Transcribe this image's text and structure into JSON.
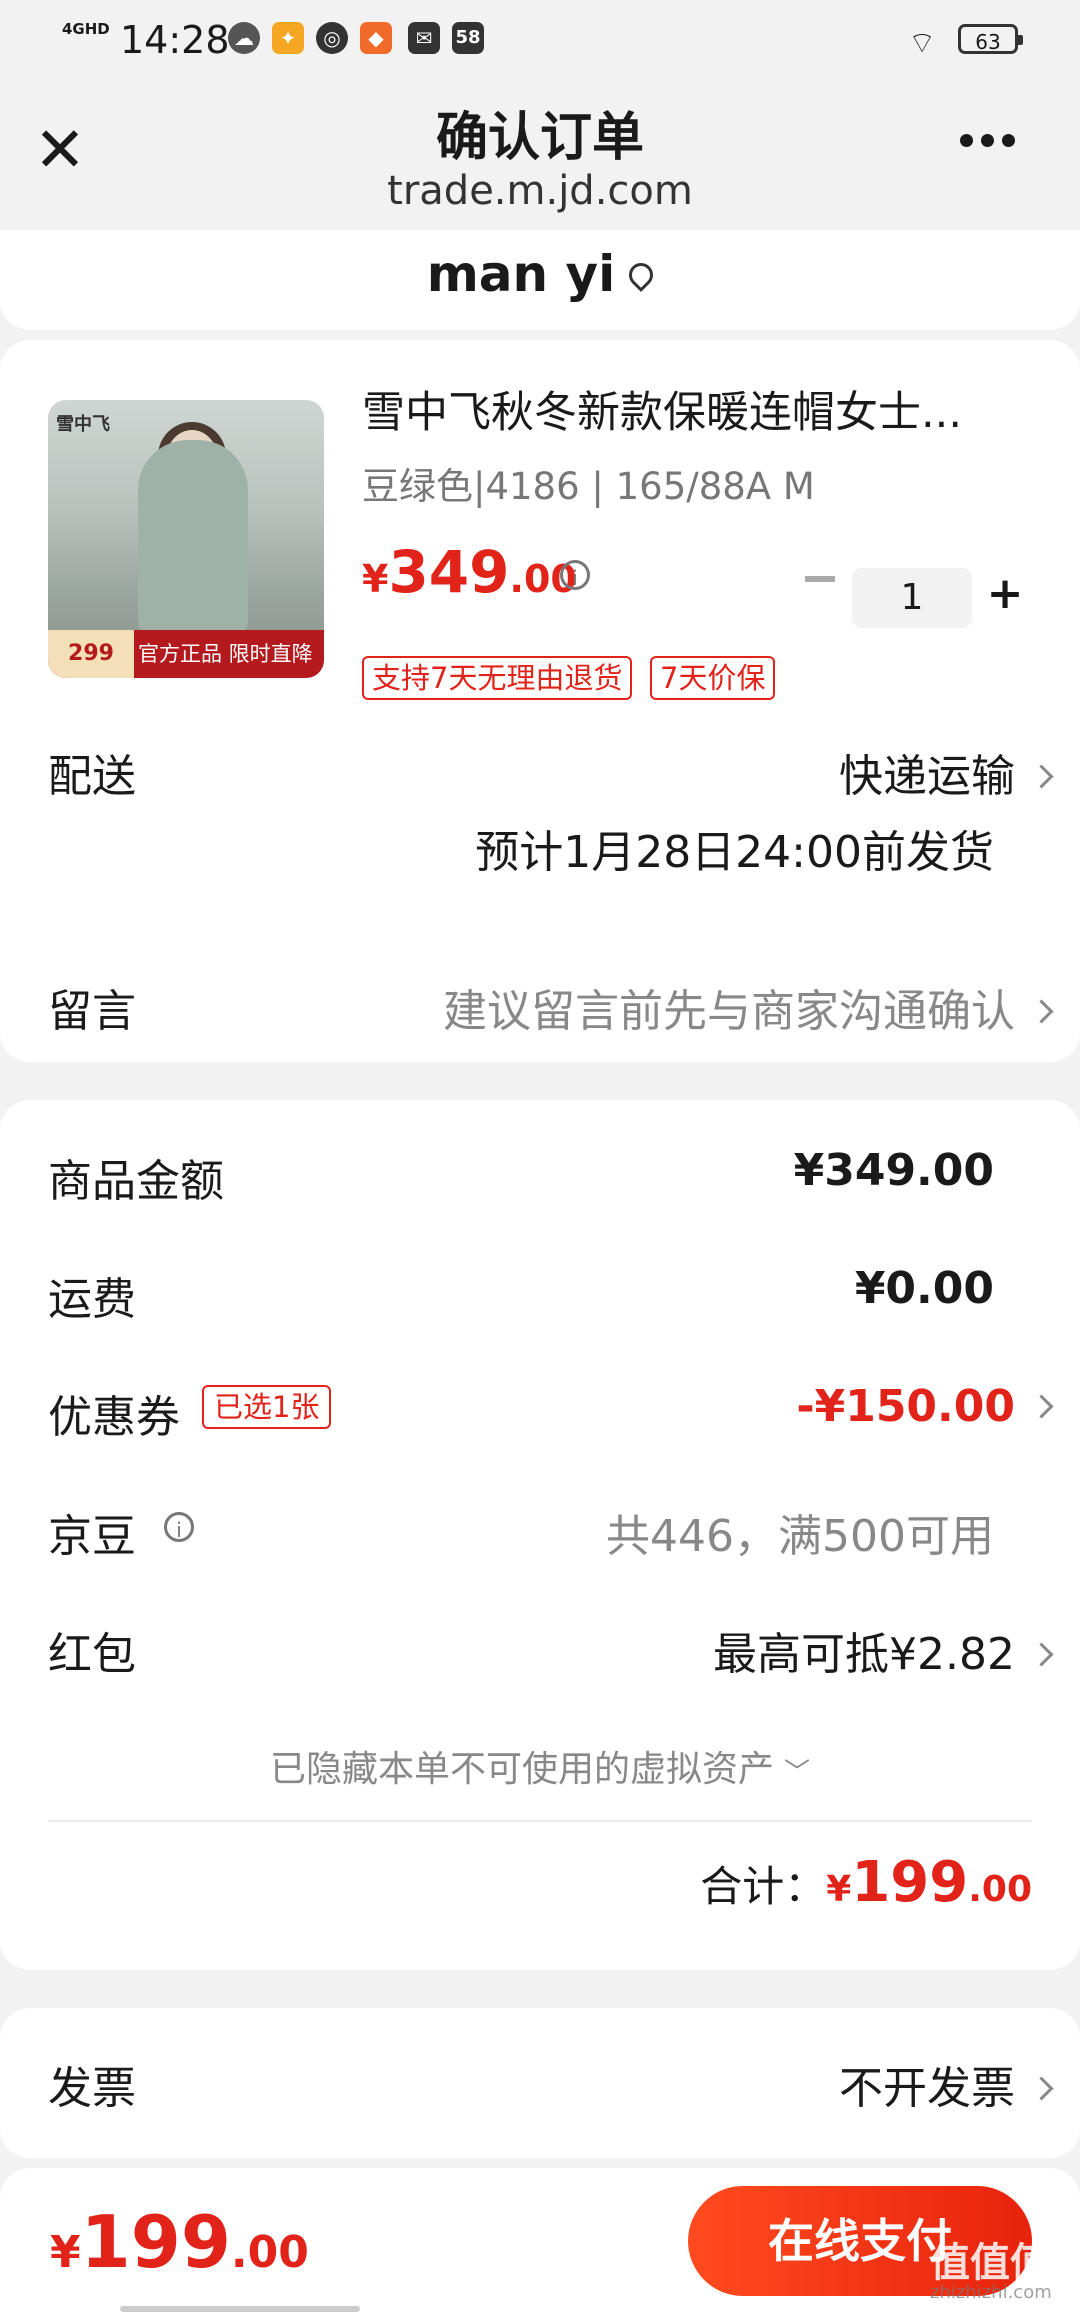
{
  "status_bar": {
    "network": "4GHD",
    "time": "14:28",
    "notif_badge": "58",
    "battery": "63"
  },
  "header": {
    "title": "确认订单",
    "url": "trade.m.jd.com"
  },
  "address": {
    "name": "man yi"
  },
  "product": {
    "name": "雪中飞秋冬新款保暖连帽女士...",
    "spec": "豆绿色|4186 | 165/88A M",
    "price_symbol": "¥",
    "price_int": "349",
    "price_dec": ".00",
    "quantity": "1",
    "tags": [
      "支持7天无理由退货",
      "7天价保"
    ],
    "image_logo": "雪中飞",
    "image_price": "299",
    "image_banner": "官方正品 限时直降"
  },
  "delivery": {
    "label": "配送",
    "method": "快递运输",
    "eta": "预计1月28日24:00前发货"
  },
  "message": {
    "label": "留言",
    "placeholder": "建议留言前先与商家沟通确认"
  },
  "summary": {
    "goods_label": "商品金额",
    "goods_value": "¥349.00",
    "shipping_label": "运费",
    "shipping_value": "¥0.00",
    "coupon_label": "优惠券",
    "coupon_badge": "已选1张",
    "coupon_value": "-¥150.00",
    "jingdou_label": "京豆",
    "jingdou_value": "共446，满500可用",
    "redpacket_label": "红包",
    "redpacket_value": "最高可抵¥2.82",
    "hidden_note": "已隐藏本单不可使用的虚拟资产",
    "total_label": "合计：",
    "total_symbol": "¥",
    "total_int": "199",
    "total_dec": ".00"
  },
  "invoice": {
    "label": "发票",
    "value": "不开发票"
  },
  "bottom_bar": {
    "price_symbol": "¥",
    "price_int": "199",
    "price_dec": ".00",
    "pay_label": "在线支付",
    "watermark": "值值值",
    "watermark_sub": "zhizhizhi.com"
  },
  "colors": {
    "accent_red": "#e2231a",
    "pay_gradient_start": "#ff4b1f",
    "pay_gradient_end": "#e8220c"
  }
}
